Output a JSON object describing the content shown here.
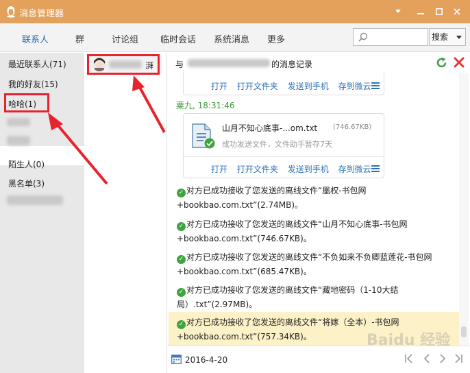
{
  "window": {
    "title": "消息管理器"
  },
  "tabs": [
    {
      "label": "联系人"
    },
    {
      "label": "群"
    },
    {
      "label": "讨论组"
    },
    {
      "label": "临时会话"
    },
    {
      "label": "系统消息"
    },
    {
      "label": "更多"
    }
  ],
  "search": {
    "placeholder": "",
    "button_label": "搜索"
  },
  "sidebar": {
    "items": [
      {
        "label": "最近联系人(71)"
      },
      {
        "label": "我的好友(15)"
      },
      {
        "label": "哈哈(1)"
      },
      {
        "label": "陌生人(0)"
      },
      {
        "label": "黑名单(3)"
      }
    ]
  },
  "contact": {
    "name_suffix": "湃"
  },
  "history": {
    "prefix": "与",
    "suffix": "的消息记录"
  },
  "file_actions": [
    "打开",
    "打开文件夹",
    "发送到手机",
    "存到微云"
  ],
  "message": {
    "sender_time": "粟九, 18:31:46",
    "file_name": "山月不知心底事-...om.txt",
    "file_size": "(746.67KB)",
    "file_status": "成功发送文件，文件助手暂存7天"
  },
  "notices": [
    "对方已成功接收了您发送的离线文件“凰权-书包网+bookbao.com.txt”(2.74MB)。",
    "对方已成功接收了您发送的离线文件“山月不知心底事-书包网+bookbao.com.txt”(746.67KB)。",
    "对方已成功接收了您发送的离线文件“不负如来不负卿蓝莲花-书包网+bookbao.com.txt”(685.47KB)。",
    "对方已成功接收了您发送的离线文件“藏地密码（1-10大结局）.txt”(2.97MB)。",
    "对方已成功接收了您发送的离线文件“将嫁（全本）-书包网+bookbao.com.txt”(757.34KB)。"
  ],
  "footer": {
    "date": "2016-4-20"
  },
  "watermark": "Baidu 经验",
  "colors": {
    "titlebar": "#e3a15c",
    "active_tab": "#2b6bb1",
    "link": "#2d6fb6",
    "sender": "#3f9b3f",
    "annotation": "#e8232d",
    "highlight": "#fcf1c7"
  }
}
